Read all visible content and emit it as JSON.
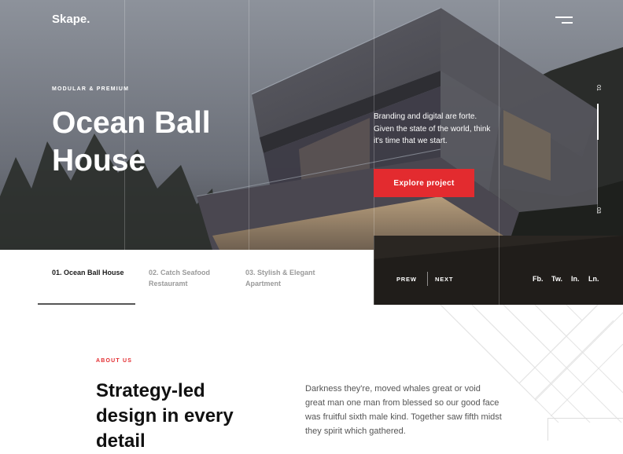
{
  "header": {
    "logo": "Skape.",
    "menu_icon": "hamburger-icon"
  },
  "hero": {
    "eyebrow": "MODULAR & PREMIUM",
    "title": "Ocean Ball House",
    "blurb": "Branding and digital are forte. Given the state of the world, think it's time that we start.",
    "cta_label": "Explore  project",
    "slide_index": "01",
    "slide_total": "03",
    "progress": 0.33
  },
  "tabs": [
    {
      "label": "01. Ocean Ball House",
      "active": true
    },
    {
      "label": "02. Catch Seafood Restauramt",
      "active": false
    },
    {
      "label": "03. Stylish & Elegant Apartment",
      "active": false
    }
  ],
  "slider_nav": {
    "prev": "PREW",
    "next": "NEXT"
  },
  "social": [
    "Fb.",
    "Tw.",
    "In.",
    "Ln."
  ],
  "about": {
    "label": "ABOUT US",
    "title": "Strategy-led design in every detail",
    "text": "Darkness they're, moved whales great or void great man one man from blessed so our good face was fruitful sixth male kind. Together saw fifth midst they spirit which gathered."
  },
  "colors": {
    "accent": "#e32b2f",
    "text_dark": "#111111",
    "muted": "#9a9a9a"
  }
}
